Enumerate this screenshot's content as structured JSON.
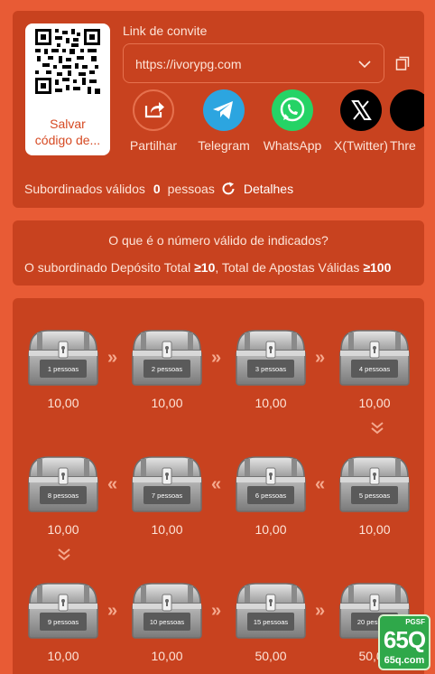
{
  "invite": {
    "qr_caption_line1": "Salvar",
    "qr_caption_line2": "código de...",
    "link_label": "Link de convite",
    "link_value": "https://ivorypg.com",
    "share": [
      {
        "label": "Partilhar",
        "icon": "share-icon",
        "color": "#c8421f"
      },
      {
        "label": "Telegram",
        "icon": "telegram-icon",
        "color": "#2ca5e0"
      },
      {
        "label": "WhatsApp",
        "icon": "whatsapp-icon",
        "color": "#25d366"
      },
      {
        "label": "X(Twitter)",
        "icon": "x-twitter-icon",
        "color": "#000000"
      },
      {
        "label": "Thre",
        "icon": "threads-icon",
        "color": "#000000"
      }
    ],
    "subordinates_label": "Subordinados válidos",
    "subordinates_count": "0",
    "subordinates_unit": "pessoas",
    "details_label": "Detalhes"
  },
  "rule": {
    "question": "O que é o número válido de indicados?",
    "prefix": "O subordinado Depósito Total ",
    "deposit": "≥10",
    "middle": ",  Total de Apostas Válidas ",
    "bets": "≥100"
  },
  "chests": [
    {
      "label": "1 pessoas",
      "value": "10,00"
    },
    {
      "label": "2 pessoas",
      "value": "10,00"
    },
    {
      "label": "3 pessoas",
      "value": "10,00"
    },
    {
      "label": "4 pessoas",
      "value": "10,00"
    },
    {
      "label": "5 pessoas",
      "value": "10,00"
    },
    {
      "label": "6 pessoas",
      "value": "10,00"
    },
    {
      "label": "7 pessoas",
      "value": "10,00"
    },
    {
      "label": "8 pessoas",
      "value": "10,00"
    },
    {
      "label": "9 pessoas",
      "value": "10,00"
    },
    {
      "label": "10 pessoas",
      "value": "10,00"
    },
    {
      "label": "15 pessoas",
      "value": "50,00"
    },
    {
      "label": "20 pessoas",
      "value": "50,00"
    }
  ],
  "logo": {
    "top": "PGSF",
    "main": "65Q",
    "domain": "65q.com"
  }
}
